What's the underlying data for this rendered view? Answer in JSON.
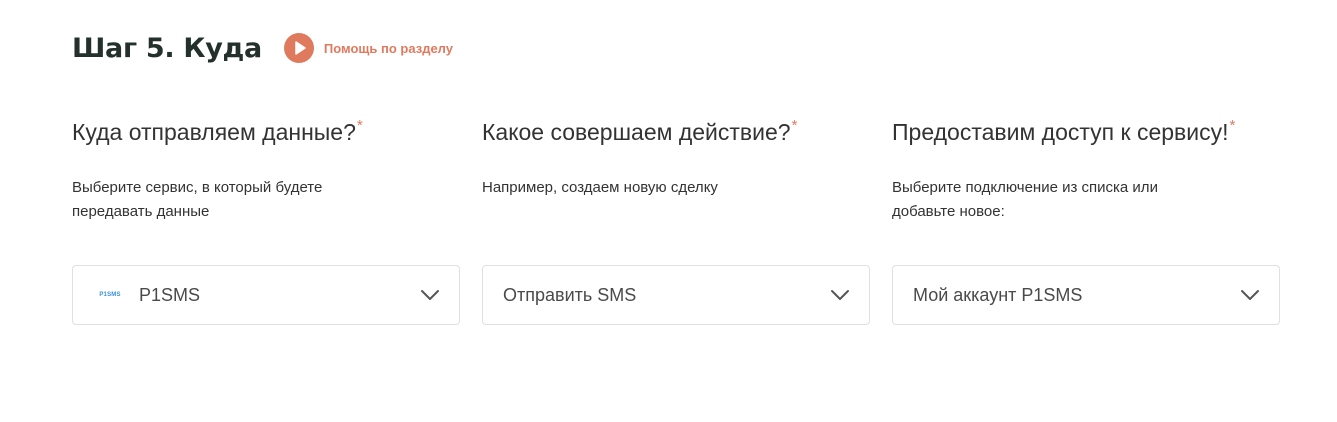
{
  "colors": {
    "accent": "#e07a5f",
    "title": "#24302c",
    "text": "#333333",
    "muted": "#4a4a4a",
    "border": "#e0e0e0",
    "chevron": "#555555",
    "logo": "#3a8fd8"
  },
  "step": {
    "title": "Шаг 5. Куда",
    "help_icon": "play-icon",
    "help_label": "Помощь по разделу"
  },
  "columns": [
    {
      "question": "Куда отправляем данные?",
      "required_mark": "*",
      "hint": "Выберите сервис, в который будете передавать данные",
      "select": {
        "logo_text": "P1SMS",
        "value": "P1SMS",
        "icon": "chevron-down-icon"
      }
    },
    {
      "question": "Какое совершаем действие?",
      "required_mark": "*",
      "hint": "Например, создаем новую сделку",
      "select": {
        "value": "Отправить SMS",
        "icon": "chevron-down-icon"
      }
    },
    {
      "question": "Предоставим доступ к сервису!",
      "required_mark": "*",
      "hint": "Выберите подключение из списка или добавьте новое:",
      "select": {
        "value": "Мой аккаунт P1SMS",
        "icon": "chevron-down-icon"
      }
    }
  ]
}
